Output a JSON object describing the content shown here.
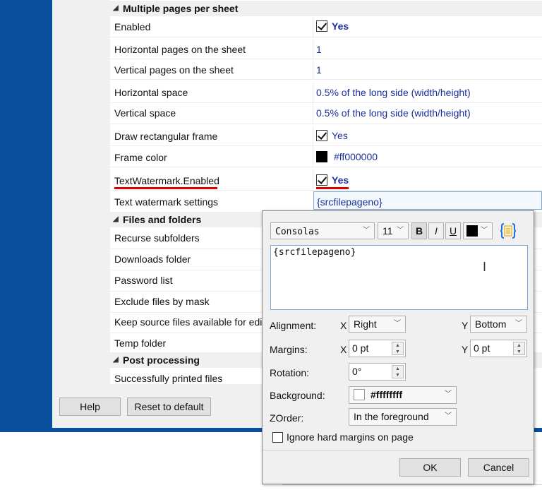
{
  "properties": {
    "categories": {
      "multiple_pages": "Multiple pages per sheet",
      "files_folders": "Files and folders",
      "post_processing": "Post processing"
    },
    "rows": {
      "enabled": {
        "label": "Enabled",
        "value": "Yes"
      },
      "h_pages": {
        "label": "Horizontal pages on the sheet",
        "value": "1"
      },
      "v_pages": {
        "label": "Vertical pages on the sheet",
        "value": "1"
      },
      "h_space": {
        "label": "Horizontal space",
        "value": "0.5% of the long side (width/height)"
      },
      "v_space": {
        "label": "Vertical space",
        "value": "0.5% of the long side (width/height)"
      },
      "draw_frame": {
        "label": "Draw rectangular frame",
        "value": "Yes"
      },
      "frame_color": {
        "label": "Frame color",
        "value": "#ff000000"
      },
      "watermark_enabled": {
        "label": "TextWatermark.Enabled",
        "value": "Yes"
      },
      "watermark_settings": {
        "label": "Text watermark settings",
        "value": "{srcfilepageno}"
      },
      "recurse": {
        "label": "Recurse subfolders"
      },
      "downloads": {
        "label": "Downloads folder"
      },
      "password": {
        "label": "Password list"
      },
      "exclude": {
        "label": "Exclude files by mask"
      },
      "keep_source": {
        "label": "Keep source files available for editing"
      },
      "temp": {
        "label": "Temp folder"
      },
      "printed": {
        "label": "Successfully printed files"
      }
    }
  },
  "buttons": {
    "help": "Help",
    "reset": "Reset to default"
  },
  "popup": {
    "font": "Consolas",
    "size": "11",
    "bold": "B",
    "italic": "I",
    "underline": "U",
    "text": "{srcfilepageno}",
    "alignment_label": "Alignment:",
    "x": "X",
    "y": "Y",
    "align_x": "Right",
    "align_y": "Bottom",
    "margins_label": "Margins:",
    "margin_x": "0 pt",
    "margin_y": "0 pt",
    "rotation_label": "Rotation:",
    "rotation": "0°",
    "background_label": "Background:",
    "background": "#ffffffff",
    "zorder_label": "ZOrder:",
    "zorder": "In the foreground",
    "ignore_margins": "Ignore hard margins on page",
    "ok": "OK",
    "cancel": "Cancel"
  },
  "colors": {
    "accent_blue": "#0a4e9e",
    "value_blue": "#1a2f9c",
    "highlight_red": "#e00000"
  },
  "icons": {
    "insert_macro": "braces-document-icon"
  }
}
